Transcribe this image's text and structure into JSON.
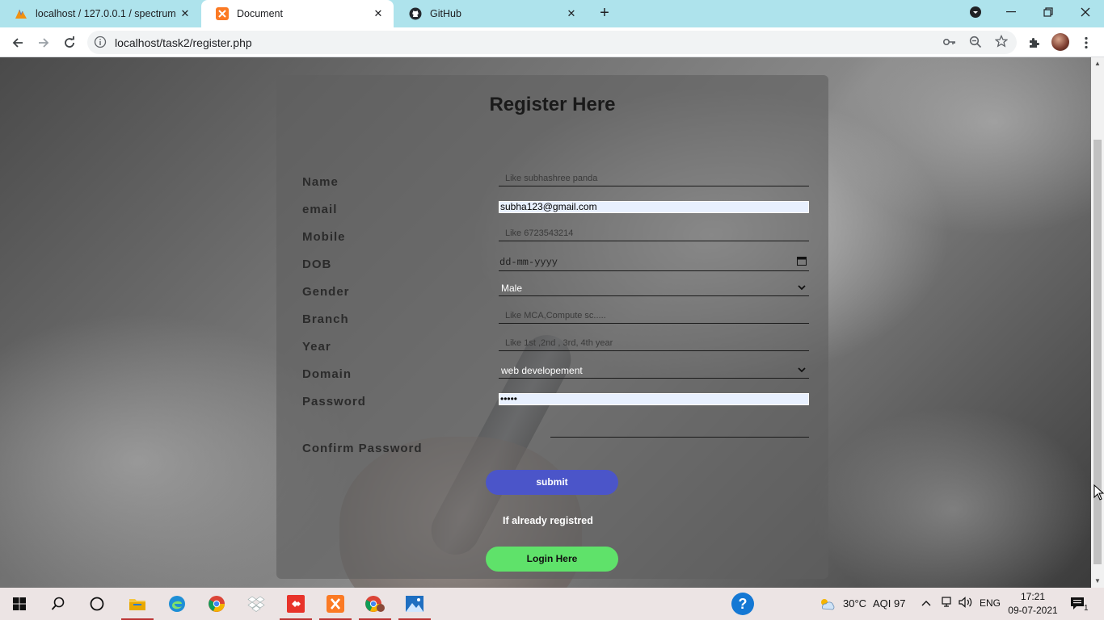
{
  "browser": {
    "tabs": [
      {
        "title": "localhost / 127.0.0.1 / spectrum /",
        "favicon": "phpmyadmin-icon"
      },
      {
        "title": "Document",
        "favicon": "xampp-icon"
      },
      {
        "title": "GitHub",
        "favicon": "github-icon"
      }
    ],
    "url": "localhost/task2/register.php"
  },
  "form": {
    "title": "Register Here",
    "labels": {
      "name": "Name",
      "email": "email",
      "mobile": "Mobile",
      "dob": "DOB",
      "gender": "Gender",
      "branch": "Branch",
      "year": "Year",
      "domain": "Domain",
      "password": "Password",
      "confirm_password": "Confirm Password"
    },
    "placeholders": {
      "name": "Like subhashree panda",
      "mobile": "Like 6723543214",
      "dob": "dd-mm-yyyy",
      "branch": "Like MCA,Compute sc.....",
      "year": "Like 1st ,2nd , 3rd, 4th year"
    },
    "values": {
      "email": "subha123@gmail.com",
      "gender": "Male",
      "domain": "web developement",
      "password": "•••••"
    },
    "submit_label": "submit",
    "already_text": "If already registred",
    "login_label": "Login Here"
  },
  "taskbar": {
    "weather": "30°C",
    "aqi": "AQI 97",
    "language": "ENG",
    "time": "17:21",
    "date": "09-07-2021",
    "notification_count": "1"
  },
  "colors": {
    "submit_bg": "#4b55c9",
    "login_bg": "#5fe26a",
    "tabstrip_bg": "#aee3ec"
  }
}
